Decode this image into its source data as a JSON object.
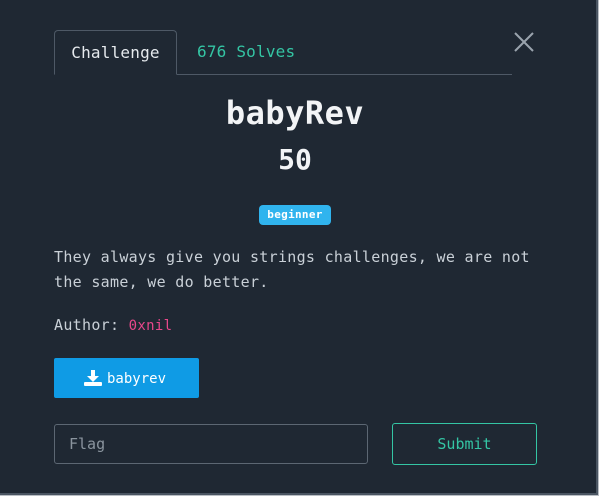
{
  "tabs": {
    "challenge_label": "Challenge",
    "solves_label": "676 Solves"
  },
  "close_icon": "close-icon",
  "challenge": {
    "name": "babyRev",
    "points": "50",
    "tag": "beginner",
    "description": "They always give you strings challenges, we are not the same, we do better.",
    "author_label": "Author:",
    "author_name": "0xnil"
  },
  "download": {
    "icon": "download-icon",
    "label": "babyrev"
  },
  "form": {
    "flag_placeholder": "Flag",
    "flag_value": "",
    "submit_label": "Submit"
  },
  "colors": {
    "background": "#1f2833",
    "accent_teal": "#34c5a4",
    "badge_blue": "#30b4ee",
    "download_blue": "#0f9be5",
    "author_pink": "#e8488b"
  }
}
